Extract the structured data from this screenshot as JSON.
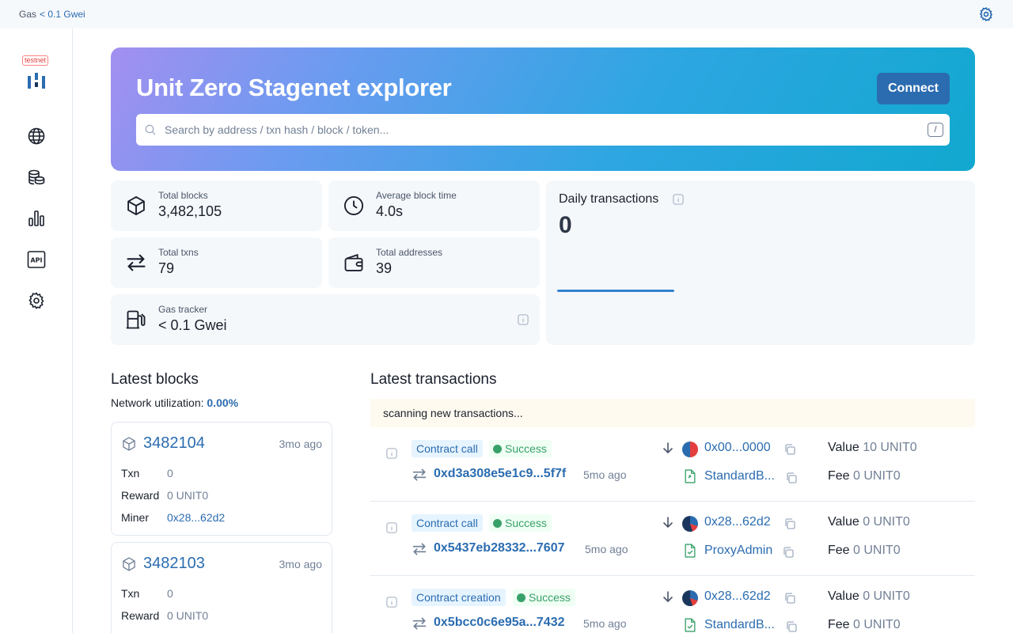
{
  "topbar": {
    "gas_label": "Gas",
    "gas_value": "< 0.1 Gwei"
  },
  "sidebar": {
    "badge": "testnet",
    "nav": [
      "globe-icon",
      "tokens-icon",
      "stats-icon",
      "api-icon",
      "settings-icon"
    ]
  },
  "hero": {
    "title": "Unit Zero Stagenet explorer",
    "connect_label": "Connect",
    "search_placeholder": "Search by address / txn hash / block / token...",
    "shortcut": "/"
  },
  "stats": {
    "total_blocks": {
      "label": "Total blocks",
      "value": "3,482,105"
    },
    "avg_block_time": {
      "label": "Average block time",
      "value": "4.0s"
    },
    "total_txns": {
      "label": "Total txns",
      "value": "79"
    },
    "total_addresses": {
      "label": "Total addresses",
      "value": "39"
    },
    "gas_tracker": {
      "label": "Gas tracker",
      "value": "< 0.1 Gwei"
    }
  },
  "daily": {
    "title": "Daily transactions",
    "value": "0"
  },
  "latest_blocks": {
    "title": "Latest blocks",
    "util_label": "Network utilization:",
    "util_value": "0.00%",
    "blocks": [
      {
        "number": "3482104",
        "ago": "3mo ago",
        "txn_label": "Txn",
        "txn": "0",
        "reward_label": "Reward",
        "reward": "0 UNIT0",
        "miner_label": "Miner",
        "miner": "0x28...62d2"
      },
      {
        "number": "3482103",
        "ago": "3mo ago",
        "txn_label": "Txn",
        "txn": "0",
        "reward_label": "Reward",
        "reward": "0 UNIT0"
      }
    ]
  },
  "latest_txns": {
    "title": "Latest transactions",
    "scanning": "scanning new transactions...",
    "items": [
      {
        "type": "Contract call",
        "status": "Success",
        "hash": "0xd3a308e5e1c9...5f7f",
        "ago": "5mo ago",
        "from": "0x00...0000",
        "to": "StandardB...",
        "value_label": "Value",
        "value": "10 UNIT0",
        "fee_label": "Fee",
        "fee": "0 UNIT0"
      },
      {
        "type": "Contract call",
        "status": "Success",
        "hash": "0x5437eb28332...7607",
        "ago": "5mo ago",
        "from": "0x28...62d2",
        "to": "ProxyAdmin",
        "value_label": "Value",
        "value": "0 UNIT0",
        "fee_label": "Fee",
        "fee": "0 UNIT0"
      },
      {
        "type": "Contract creation",
        "status": "Success",
        "hash": "0x5bcc0c6e95a...7432",
        "ago": "5mo ago",
        "from": "0x28...62d2",
        "to": "StandardB...",
        "value_label": "Value",
        "value": "0 UNIT0",
        "fee_label": "Fee",
        "fee": "0 UNIT0"
      }
    ]
  },
  "colors": {
    "accent": "#2b6cb0",
    "success": "#38a169",
    "hero_start": "#a38ff0",
    "hero_end": "#11a8cf"
  }
}
